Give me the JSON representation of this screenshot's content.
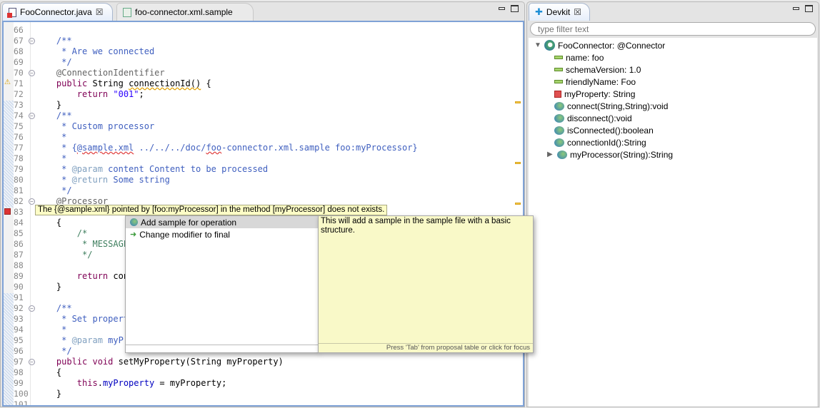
{
  "editor": {
    "tabs": [
      {
        "label": "FooConnector.java",
        "active": true,
        "icon": "java-file-error-icon"
      },
      {
        "label": "foo-connector.xml.sample",
        "active": false,
        "icon": "xml-file-icon"
      }
    ],
    "lines": [
      {
        "n": "66",
        "seg": []
      },
      {
        "n": "67",
        "fold": true,
        "seg": [
          [
            "cm",
            "    /**"
          ]
        ]
      },
      {
        "n": "68",
        "seg": [
          [
            "cm",
            "     * Are we connected"
          ]
        ]
      },
      {
        "n": "69",
        "seg": [
          [
            "cm",
            "     */"
          ]
        ]
      },
      {
        "n": "70",
        "fold": true,
        "seg": [
          [
            "an",
            "    @ConnectionIdentifier"
          ]
        ]
      },
      {
        "n": "71",
        "warn": true,
        "seg": [
          [
            "kw",
            "    public "
          ],
          [
            "plain",
            "String "
          ],
          [
            "plain sq",
            "connectionId()"
          ],
          [
            "plain",
            " {"
          ]
        ]
      },
      {
        "n": "72",
        "seg": [
          [
            "kw",
            "        return "
          ],
          [
            "str",
            "\"001\""
          ],
          [
            "plain",
            ";"
          ]
        ]
      },
      {
        "n": "73",
        "seg": [
          [
            "plain",
            "    }"
          ]
        ]
      },
      {
        "n": "74",
        "fold": true,
        "seg": [
          [
            "cm",
            "    /**"
          ]
        ]
      },
      {
        "n": "75",
        "seg": [
          [
            "cm",
            "     * Custom processor"
          ]
        ]
      },
      {
        "n": "76",
        "seg": [
          [
            "cm",
            "     *"
          ]
        ]
      },
      {
        "n": "77",
        "seg": [
          [
            "cm",
            "     * {"
          ],
          [
            "cm sqr",
            "@sample.xml"
          ],
          [
            "cm",
            " ../../../doc/"
          ],
          [
            "cm sqr",
            "foo"
          ],
          [
            "cm",
            "-connector.xml.sample foo:myProcessor}"
          ]
        ]
      },
      {
        "n": "78",
        "seg": [
          [
            "cm",
            "     *"
          ]
        ]
      },
      {
        "n": "79",
        "seg": [
          [
            "cm",
            "     * "
          ],
          [
            "tag",
            "@param"
          ],
          [
            "cm",
            " content Content to be processed"
          ]
        ]
      },
      {
        "n": "80",
        "seg": [
          [
            "cm",
            "     * "
          ],
          [
            "tag",
            "@return"
          ],
          [
            "cm",
            " Some string"
          ]
        ]
      },
      {
        "n": "81",
        "seg": [
          [
            "cm",
            "     */"
          ]
        ]
      },
      {
        "n": "82",
        "fold": true,
        "seg": [
          [
            "an",
            "    @Processor"
          ]
        ]
      },
      {
        "n": "83",
        "error": true,
        "seg": []
      },
      {
        "n": "84",
        "seg": [
          [
            "plain",
            "    {"
          ]
        ]
      },
      {
        "n": "85",
        "seg": [
          [
            "gc",
            "        /*"
          ]
        ]
      },
      {
        "n": "86",
        "seg": [
          [
            "gc",
            "         * MESSAGE"
          ]
        ]
      },
      {
        "n": "87",
        "seg": [
          [
            "gc",
            "         */"
          ]
        ]
      },
      {
        "n": "88",
        "seg": []
      },
      {
        "n": "89",
        "seg": [
          [
            "kw",
            "        return "
          ],
          [
            "plain",
            "con"
          ]
        ]
      },
      {
        "n": "90",
        "seg": [
          [
            "plain",
            "    }"
          ]
        ]
      },
      {
        "n": "91",
        "seg": []
      },
      {
        "n": "92",
        "fold": true,
        "seg": [
          [
            "cm",
            "    /**"
          ]
        ]
      },
      {
        "n": "93",
        "seg": [
          [
            "cm",
            "     * Set propert"
          ]
        ]
      },
      {
        "n": "94",
        "seg": [
          [
            "cm",
            "     *"
          ]
        ]
      },
      {
        "n": "95",
        "seg": [
          [
            "cm",
            "     * "
          ],
          [
            "tag",
            "@param"
          ],
          [
            "cm",
            " myPr"
          ]
        ]
      },
      {
        "n": "96",
        "seg": [
          [
            "cm",
            "     */"
          ]
        ]
      },
      {
        "n": "97",
        "fold": true,
        "seg": [
          [
            "kw",
            "    public void "
          ],
          [
            "plain",
            "setMyProperty(String myProperty)"
          ]
        ]
      },
      {
        "n": "98",
        "seg": [
          [
            "plain",
            "    {"
          ]
        ]
      },
      {
        "n": "99",
        "seg": [
          [
            "kw",
            "        this"
          ],
          [
            "plain",
            "."
          ],
          [
            "fld",
            "myProperty"
          ],
          [
            "plain",
            " = myProperty;"
          ]
        ]
      },
      {
        "n": "100",
        "seg": [
          [
            "plain",
            "    }"
          ]
        ]
      },
      {
        "n": "101",
        "seg": []
      }
    ],
    "tooltip": "The {@sample.xml} pointed by [foo:myProcessor] in the method [myProcessor] does not exists.",
    "quickfix": {
      "proposals": [
        {
          "label": "Add sample for operation",
          "icon": "devkit-add-icon",
          "selected": true
        },
        {
          "label": "Change modifier to final",
          "icon": "green-arrow-icon",
          "selected": false
        }
      ],
      "info": "This will add a sample in the sample file with a basic structure.",
      "footer": "Press 'Tab' from proposal table or click for focus"
    }
  },
  "devkit": {
    "tab_label": "Devkit",
    "filter_placeholder": "type filter text",
    "tree": [
      {
        "label": "FooConnector: @Connector",
        "icon": "connector-icon",
        "level": 0,
        "expander": "expanded"
      },
      {
        "label": "name: foo",
        "icon": "property-icon",
        "level": 1
      },
      {
        "label": "schemaVersion: 1.0",
        "icon": "property-icon",
        "level": 1
      },
      {
        "label": "friendlyName: Foo",
        "icon": "property-icon",
        "level": 1
      },
      {
        "label": "myProperty: String",
        "icon": "field-icon",
        "level": 1
      },
      {
        "label": "connect(String,String):void",
        "icon": "method-icon",
        "level": 1
      },
      {
        "label": "disconnect():void",
        "icon": "method-icon",
        "level": 1
      },
      {
        "label": "isConnected():boolean",
        "icon": "method-icon",
        "level": 1
      },
      {
        "label": "connectionId():String",
        "icon": "method-icon",
        "level": 1
      },
      {
        "label": "myProcessor(String):String",
        "icon": "processor-icon",
        "level": 1,
        "expander": "collapsed"
      }
    ]
  }
}
